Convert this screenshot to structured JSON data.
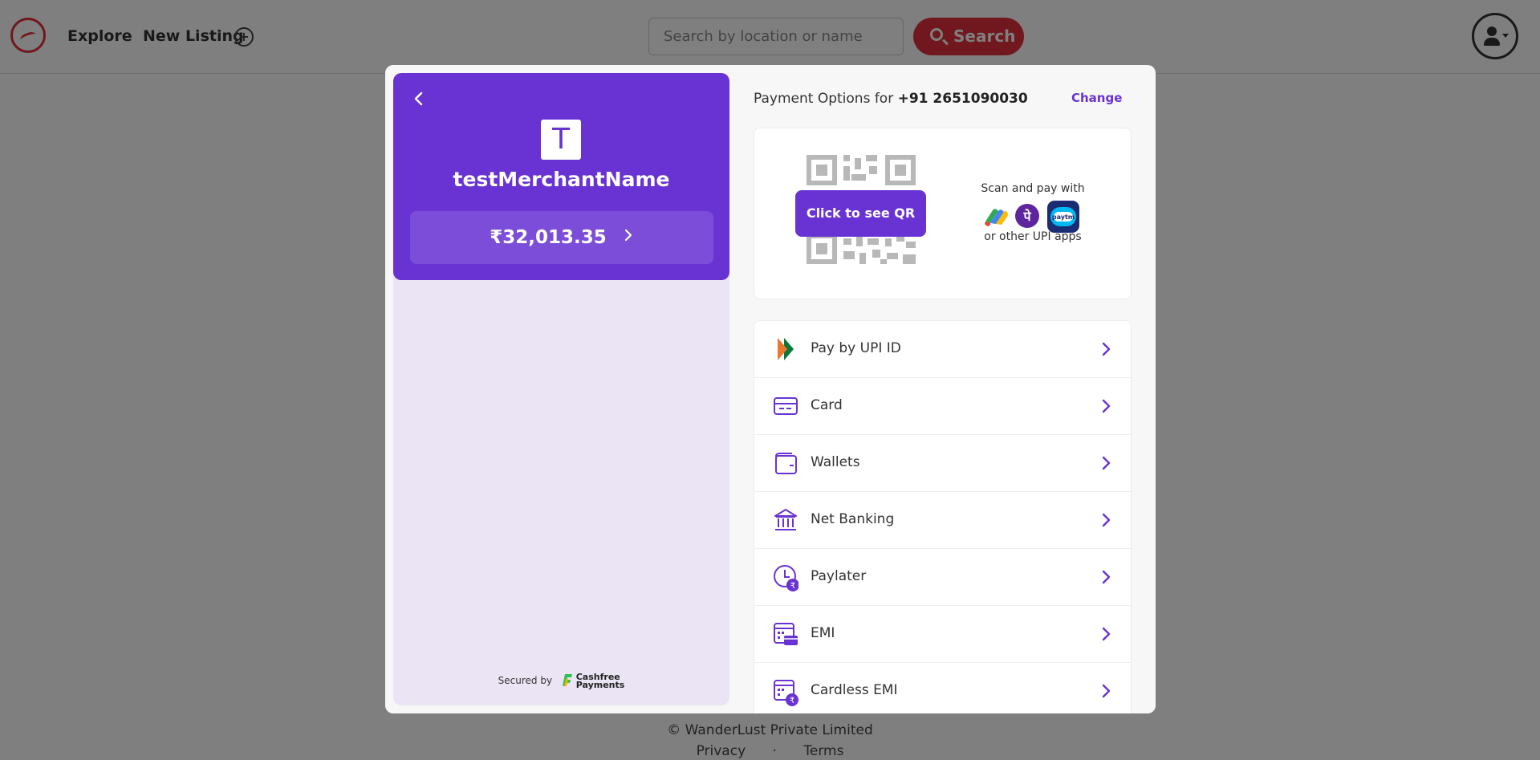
{
  "background": {
    "nav": {
      "explore": "Explore",
      "new_listing": "New Listing",
      "plus": "+"
    },
    "search": {
      "placeholder": "Search by location or name",
      "button": "Search"
    },
    "footer": {
      "copyright": "© WanderLust Private Limited",
      "privacy": "Privacy",
      "terms": "Terms"
    }
  },
  "checkout": {
    "merchant": {
      "initial": "T",
      "name": "testMerchantName"
    },
    "amount": "₹32,013.35",
    "secured_by": "Secured by",
    "provider": {
      "line1": "Cashfree",
      "line2": "Payments"
    },
    "payment_for_label": "Payment Options for",
    "phone": "+91 2651090030",
    "change": "Change",
    "qr": {
      "button": "Click to see QR",
      "scan_text": "Scan and pay with",
      "other_text": "or other UPI apps",
      "apps": [
        "google-pay-icon",
        "phonepe-icon",
        "paytm-icon"
      ]
    },
    "options": [
      {
        "label": "Pay by UPI ID",
        "icon": "upi-icon"
      },
      {
        "label": "Card",
        "icon": "card-icon"
      },
      {
        "label": "Wallets",
        "icon": "wallet-icon"
      },
      {
        "label": "Net Banking",
        "icon": "bank-icon"
      },
      {
        "label": "Paylater",
        "icon": "paylater-icon"
      },
      {
        "label": "EMI",
        "icon": "emi-icon"
      },
      {
        "label": "Cardless EMI",
        "icon": "cardless-emi-icon"
      }
    ],
    "colors": {
      "primary": "#6933d3",
      "brand_red": "#e0313a"
    }
  }
}
